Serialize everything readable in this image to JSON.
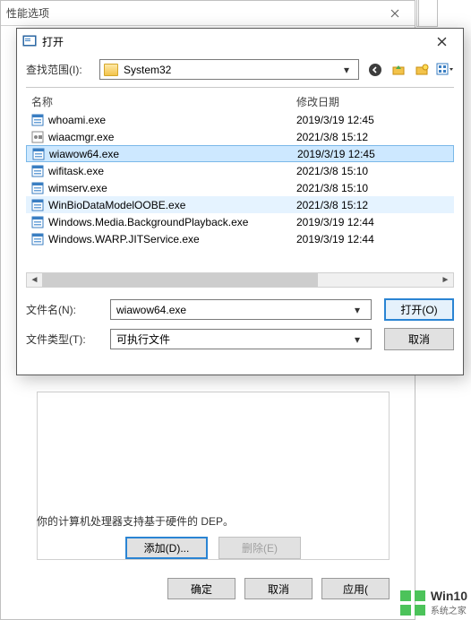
{
  "bg": {
    "title": "性能选项",
    "add_btn": "添加(D)...",
    "delete_btn": "删除(E)",
    "note": "你的计算机处理器支持基于硬件的 DEP。",
    "ok": "确定",
    "cancel": "取消",
    "apply": "应用("
  },
  "open": {
    "title": "打开",
    "scope_label": "查找范围(I):",
    "scope_value": "System32",
    "col_name": "名称",
    "col_date": "修改日期",
    "rows": [
      {
        "name": "whoami.exe",
        "date": "2019/3/19 12:45",
        "icon": "exe"
      },
      {
        "name": "wiaacmgr.exe",
        "date": "2021/3/8 15:12",
        "icon": "app"
      },
      {
        "name": "wiawow64.exe",
        "date": "2019/3/19 12:45",
        "icon": "exe",
        "selected": true
      },
      {
        "name": "wifitask.exe",
        "date": "2021/3/8 15:10",
        "icon": "exe"
      },
      {
        "name": "wimserv.exe",
        "date": "2021/3/8 15:10",
        "icon": "exe"
      },
      {
        "name": "WinBioDataModelOOBE.exe",
        "date": "2021/3/8 15:12",
        "icon": "exe",
        "hover": true
      },
      {
        "name": "Windows.Media.BackgroundPlayback.exe",
        "date": "2019/3/19 12:44",
        "icon": "exe"
      },
      {
        "name": "Windows.WARP.JITService.exe",
        "date": "2019/3/19 12:44",
        "icon": "exe"
      }
    ],
    "filename_label": "文件名(N):",
    "filename_value": "wiawow64.exe",
    "filetype_label": "文件类型(T):",
    "filetype_value": "可执行文件",
    "open_btn": "打开(O)",
    "cancel_btn": "取消"
  },
  "watermark": {
    "l1": "Win10",
    "l2": "系统之家"
  }
}
